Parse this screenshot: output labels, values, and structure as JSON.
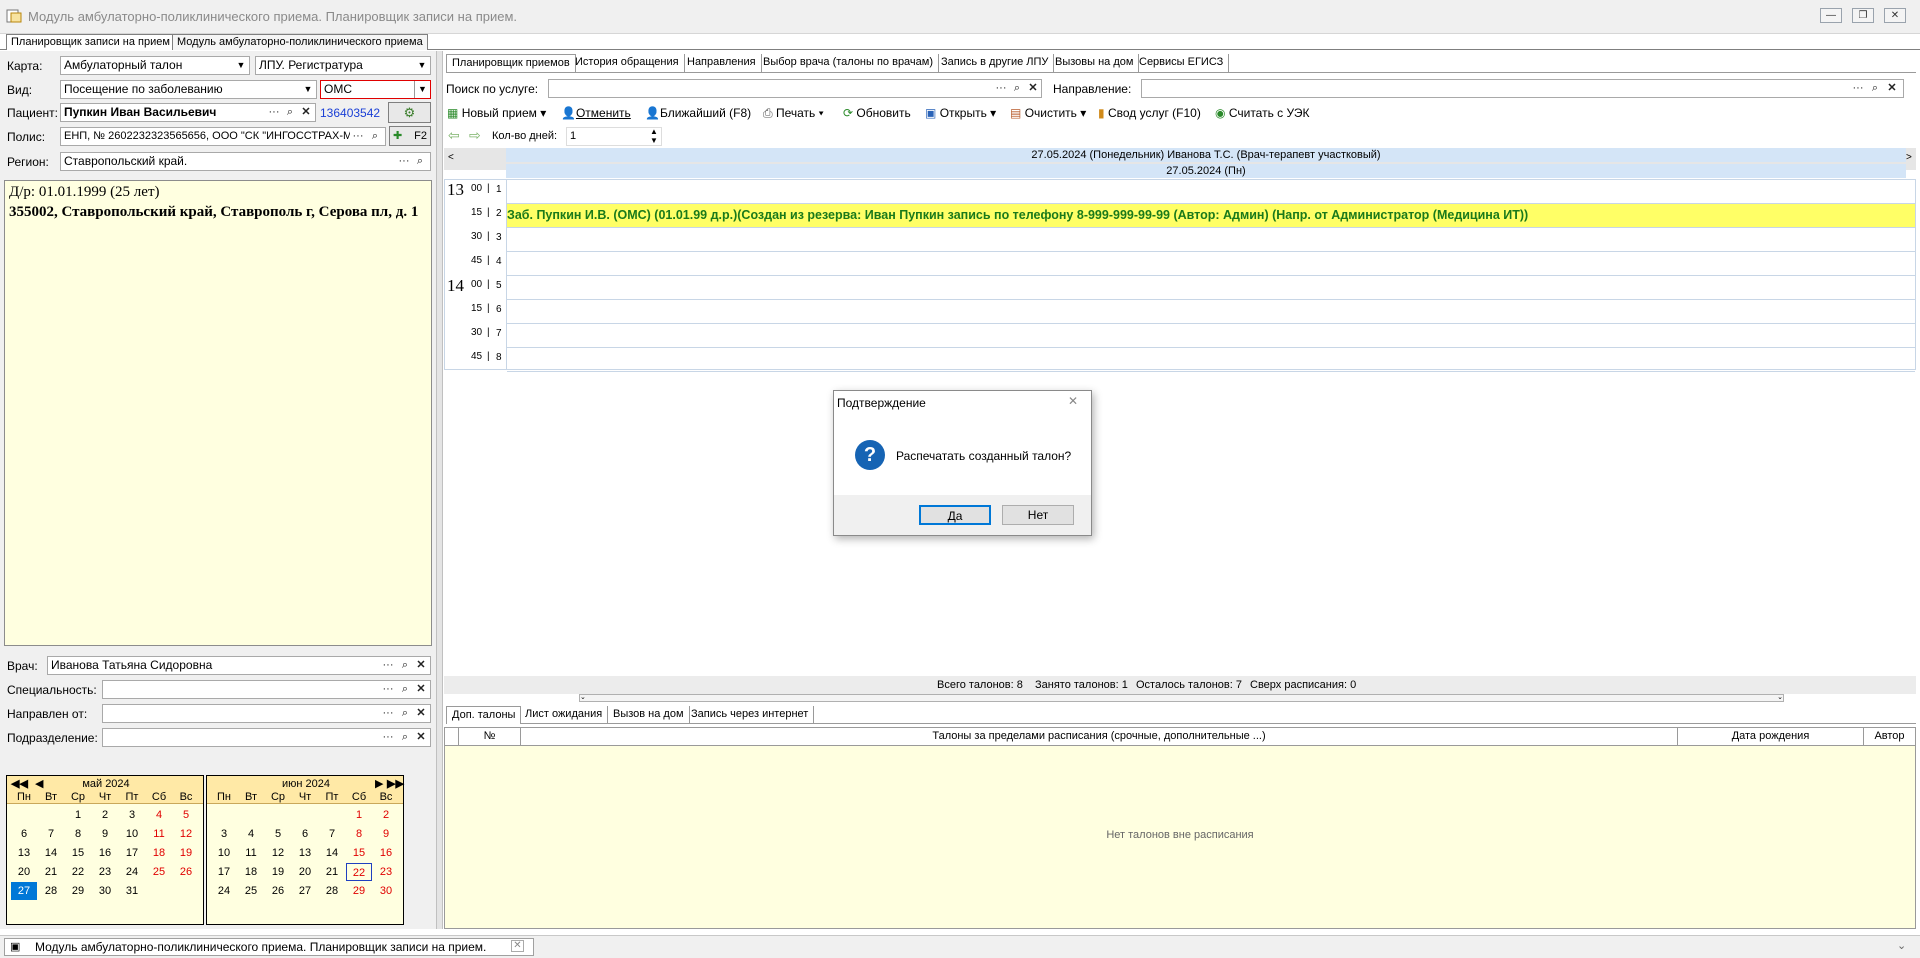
{
  "window": {
    "title": "Модуль амбулаторно-поликлинического приема. Планировщик записи на прием."
  },
  "doc_tabs": [
    "Планировщик записи на прием",
    "Модуль амбулаторно-поликлинического приема"
  ],
  "left": {
    "karta_label": "Карта:",
    "karta_value": "Амбулаторный талон",
    "lpu_value": "ЛПУ. Регистратура",
    "vid_label": "Вид:",
    "vid_value": "Посещение по заболеванию",
    "oms_value": "ОМС",
    "patient_label": "Пациент:",
    "patient_value": "Пупкин Иван Васильевич",
    "patient_id": "136403542",
    "polis_label": "Полис:",
    "polis_value": "ЕНП, № 2602232323565656, ООО \"СК \"ИНГОССТРАХ-М\"",
    "f2_label": "F2",
    "region_label": "Регион:",
    "region_value": "Ставропольский край.",
    "dob_line": "Д/р: 01.01.1999 (25 лет)",
    "address_line": "355002, Ставропольский край, Ставрополь г, Серова пл, д. 1",
    "vrach_label": "Врач:",
    "vrach_value": "Иванова Татьяна Сидоровна",
    "spec_label": "Специальность:",
    "napr_label": "Направлен от:",
    "podr_label": "Подразделение:"
  },
  "calendar": {
    "weekdays": [
      "Пн",
      "Вт",
      "Ср",
      "Чт",
      "Пт",
      "Сб",
      "Вс"
    ],
    "may": {
      "title": "май 2024",
      "offset": 2,
      "days": 31,
      "selected": 27
    },
    "june": {
      "title": "июн 2024",
      "offset": 5,
      "days": 30,
      "today": 22
    },
    "holiday_color": "#e00000",
    "selected_color": "#0078d7"
  },
  "right_tabs": [
    "Планировщик приемов",
    "История обращения",
    "Направления",
    "Выбор врача (талоны по врачам)",
    "Запись в другие ЛПУ",
    "Вызовы на дом",
    "Сервисы ЕГИСЗ"
  ],
  "search": {
    "service_label": "Поиск по услуге:",
    "direction_label": "Направление:"
  },
  "toolbar": {
    "new": "Новый прием",
    "cancel": "Отменить",
    "nearest": "Ближайший (F8)",
    "print": "Печать",
    "refresh": "Обновить",
    "open": "Открыть",
    "clear": "Очистить",
    "summary": "Свод услуг (F10)",
    "uek": "Считать с УЭК"
  },
  "days": {
    "label": "Кол-во дней:",
    "value": "1"
  },
  "schedule": {
    "header1": "27.05.2024 (Понедельник) Иванова Т.С. (Врач-терапевт участковый)",
    "header2": "27.05.2024 (Пн)",
    "hours": [
      "13",
      "14"
    ],
    "slots": [
      {
        "min": "00",
        "n": "1"
      },
      {
        "min": "15",
        "n": "2"
      },
      {
        "min": "30",
        "n": "3"
      },
      {
        "min": "45",
        "n": "4"
      },
      {
        "min": "00",
        "n": "5"
      },
      {
        "min": "15",
        "n": "6"
      },
      {
        "min": "30",
        "n": "7"
      },
      {
        "min": "45",
        "n": "8"
      }
    ],
    "booking": "Заб. Пупкин И.В. (ОМС) (01.01.99 д.р.)(Создан из резерва: Иван Пупкин запись по телефону 8-999-999-99-99 (Автор: Админ) (Напр. от Администратор (Медицина ИТ))",
    "booking_color": "#ffff66"
  },
  "status": {
    "total": "Всего талонов: 8",
    "busy": "Занято талонов: 1",
    "left": "Осталось талонов: 7",
    "over": "Сверх расписания: 0"
  },
  "bottom_tabs": [
    "Доп. талоны",
    "Лист ожидания",
    "Вызов на дом",
    "Запись через интернет"
  ],
  "table": {
    "columns": [
      "№",
      "Талоны за пределами расписания (срочные, дополнительные ...)",
      "Дата рождения",
      "Автор"
    ],
    "empty": "Нет талонов вне расписания"
  },
  "dialog": {
    "title": "Подтверждение",
    "message": "Распечатать созданный талон?",
    "yes": "Да",
    "no": "Нет"
  },
  "taskbar": {
    "title": "Модуль амбулаторно-поликлинического приема. Планировщик записи на прием."
  }
}
